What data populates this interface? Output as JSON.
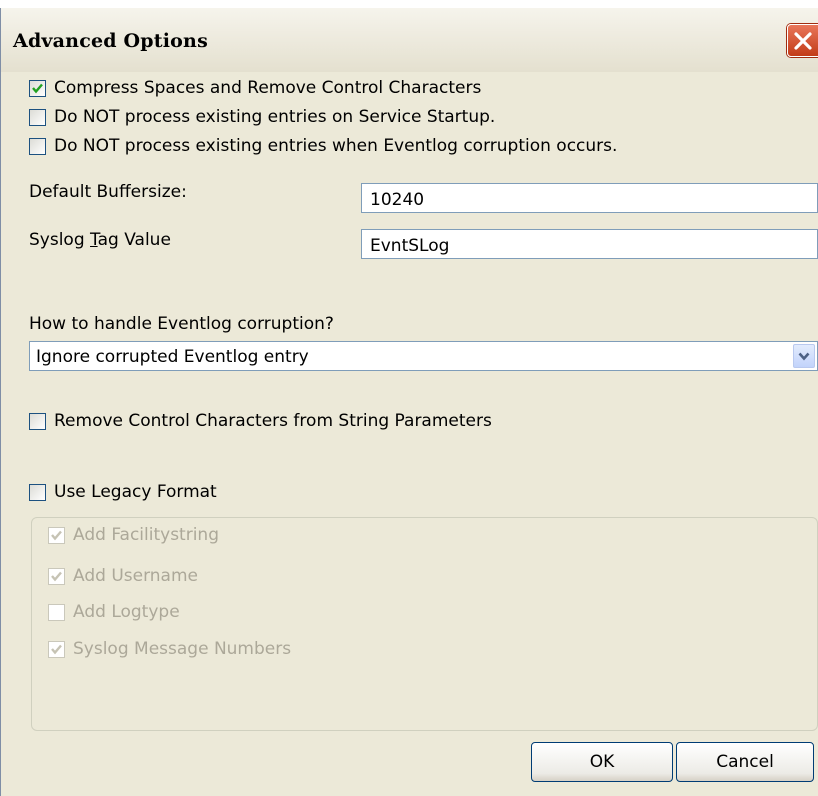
{
  "window": {
    "title": "Advanced Options",
    "close_icon": "close-x-icon"
  },
  "checkboxes_top": [
    {
      "label": "Compress Spaces and Remove Control Characters",
      "checked": true
    },
    {
      "label": "Do NOT process existing entries on Service Startup.",
      "checked": false
    },
    {
      "label": "Do NOT process existing entries when Eventlog corruption occurs.",
      "checked": false
    }
  ],
  "buffersize": {
    "label": "Default Buffersize:",
    "value": "10240"
  },
  "syslog_tag": {
    "label_prefix": "Syslog ",
    "label_underlined": "T",
    "label_suffix": "ag Value",
    "value": "EvntSLog"
  },
  "corruption": {
    "label": "How to handle Eventlog corruption?",
    "selected": "Ignore corrupted Eventlog entry"
  },
  "remove_control_chars": {
    "label": "Remove Control Characters from String Parameters",
    "checked": false
  },
  "legacy_format": {
    "label": "Use Legacy Format",
    "checked": false
  },
  "legacy_options": [
    {
      "label": "Add Facilitystring",
      "checked": true
    },
    {
      "label": "Add Username",
      "checked": true
    },
    {
      "label": "Add Logtype",
      "checked": false
    },
    {
      "label": "Syslog Message Numbers",
      "checked": true
    }
  ],
  "buttons": {
    "ok": "OK",
    "cancel": "Cancel"
  },
  "colors": {
    "dialog_bg": "#ECE9D8",
    "checkmark": "#21a121",
    "disabled_text": "#aca899",
    "close_red": "#d1532e"
  }
}
